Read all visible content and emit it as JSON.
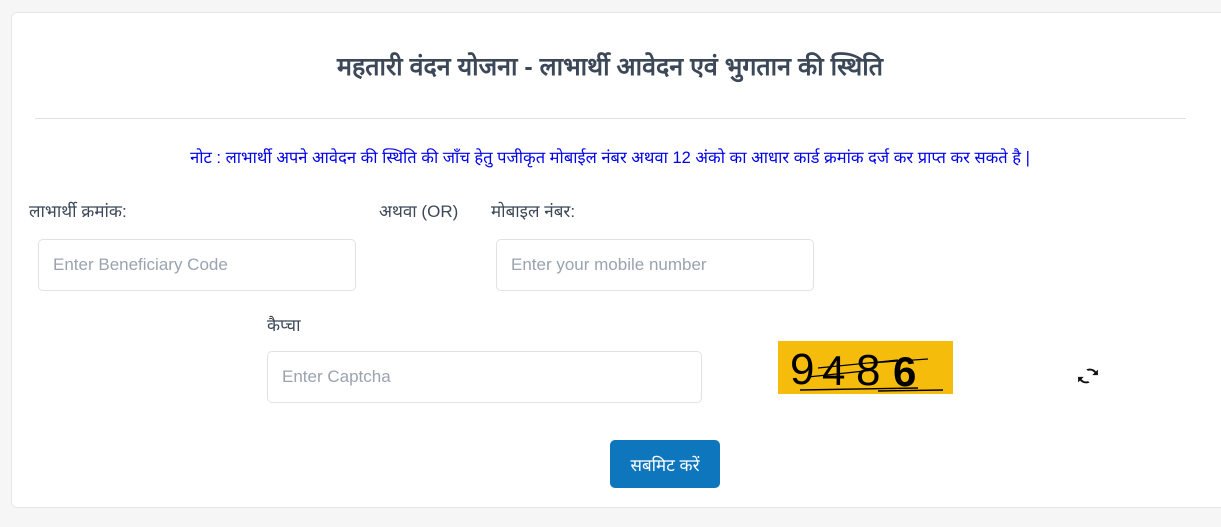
{
  "header": {
    "title": "महतारी वंदन योजना - लाभार्थी आवेदन एवं भुगतान की स्थिति"
  },
  "note": {
    "text": "नोट : लाभार्थी अपने आवेदन की स्थिति की जाँच हेतु पजीकृत मोबाईल नंबर अथवा 12 अंको का आधार कार्ड क्रमांक दर्ज कर प्राप्त कर सकते है |",
    "color": "#0000ee"
  },
  "form": {
    "beneficiary": {
      "label": "लाभार्थी क्रमांक:",
      "placeholder": "Enter Beneficiary Code",
      "value": ""
    },
    "or_separator": "अथवा (OR)",
    "mobile": {
      "label": "मोबाइल नंबर:",
      "placeholder": "Enter your mobile number",
      "value": ""
    },
    "captcha": {
      "label": "कैप्चा",
      "placeholder": "Enter Captcha",
      "value": "",
      "image_text": "9486",
      "image_background": "#f5bc0c",
      "image_foreground": "#000000",
      "refresh_icon": "refresh-icon"
    },
    "submit": {
      "label": "सबमिट करें",
      "color": "#0d76bc"
    }
  },
  "theme": {
    "page_background": "#f6f6f6",
    "card_background": "#ffffff",
    "title_color": "#3c4858",
    "label_color": "#3c4858",
    "placeholder_color": "#9aa3b0",
    "border_color": "#dfe3e9"
  }
}
